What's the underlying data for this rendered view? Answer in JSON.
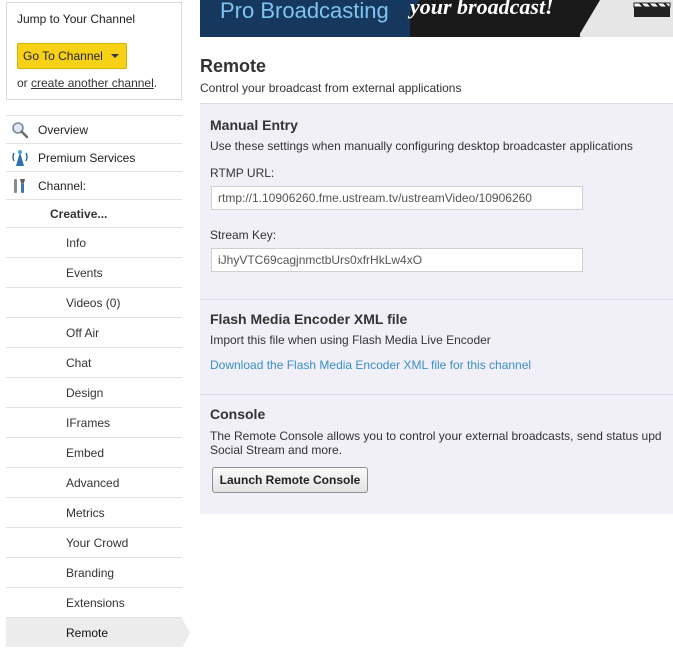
{
  "sidebar": {
    "jump_title": "Jump to Your Channel",
    "go_button": "Go To Channel",
    "create_prefix": "or ",
    "create_link": "create another channel",
    "create_suffix": ".",
    "nav": {
      "overview": "Overview",
      "premium": "Premium Services",
      "channel": "Channel:",
      "channel_name": "Creative...",
      "sub_items": [
        "Info",
        "Events",
        "Videos (0)",
        "Off Air",
        "Chat",
        "Design",
        "IFrames",
        "Embed",
        "Advanced",
        "Metrics",
        "Your Crowd",
        "Branding",
        "Extensions",
        "Remote"
      ],
      "active_item": "Remote"
    }
  },
  "banner": {
    "title": "Pro Broadcasting",
    "tagline": "your broadcast!"
  },
  "main": {
    "title": "Remote",
    "subtitle": "Control your broadcast from external applications",
    "manual": {
      "title": "Manual Entry",
      "description": "Use these settings when manually configuring desktop broadcaster applications",
      "rtmp_label": "RTMP URL:",
      "rtmp_value": "rtmp://1.10906260.fme.ustream.tv/ustreamVideo/10906260",
      "key_label": "Stream Key:",
      "key_value": "iJhyVTC69cagjnmctbUrs0xfrHkLw4xO"
    },
    "fme": {
      "title": "Flash Media Encoder XML file",
      "description": "Import this file when using Flash Media Live Encoder",
      "link": "Download the Flash Media Encoder XML file for this channel"
    },
    "console": {
      "title": "Console",
      "line1": "The Remote Console allows you to control your external broadcasts, send status upd",
      "line2": "Social Stream and more.",
      "button": "Launch Remote Console"
    }
  },
  "colors": {
    "accent_yellow": "#f7d116",
    "panel_bg": "#f1eff8",
    "link_blue": "#3a8fc9",
    "banner_blue": "#16385e"
  }
}
